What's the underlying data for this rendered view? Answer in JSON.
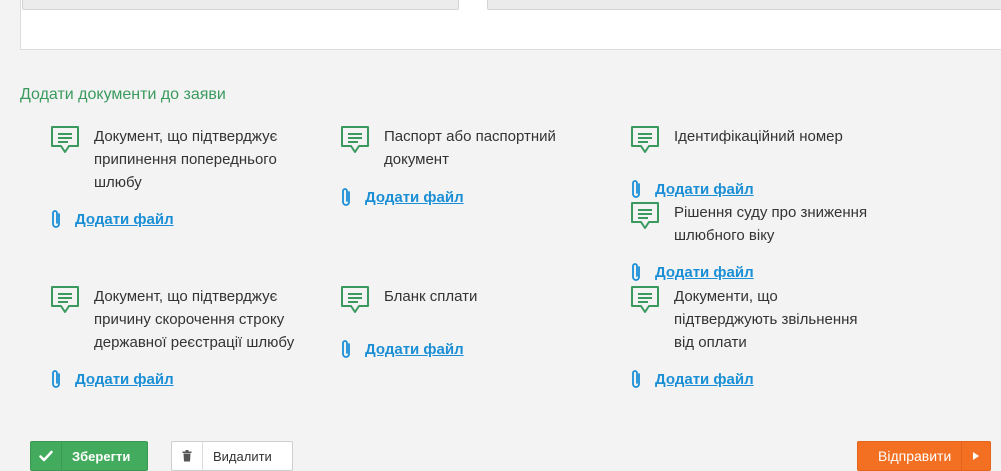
{
  "section_title": "Додати документи до заяви",
  "attach_label": "Додати файл",
  "documents": [
    {
      "label": "Документ, що підтверджує припинення попереднього шлюбу"
    },
    {
      "label": "Паспорт або паспортний документ"
    },
    {
      "label": "Ідентифікаційний номер"
    },
    {
      "label": "Рішення суду про зниження шлюбного віку"
    },
    {
      "label": "Документ, що підтверджує причину скорочення строку державної реєстрації шлюбу"
    },
    {
      "label": "Бланк сплати"
    },
    {
      "label": "Документи, що підтверджують звільнення від оплати"
    }
  ],
  "buttons": {
    "save": "Зберегти",
    "delete": "Видалити",
    "send": "Відправити"
  },
  "colors": {
    "accent_green": "#43ab5d",
    "title_green": "#3a9a5e",
    "link_blue": "#1a8fd6",
    "send_orange": "#f36f21"
  }
}
